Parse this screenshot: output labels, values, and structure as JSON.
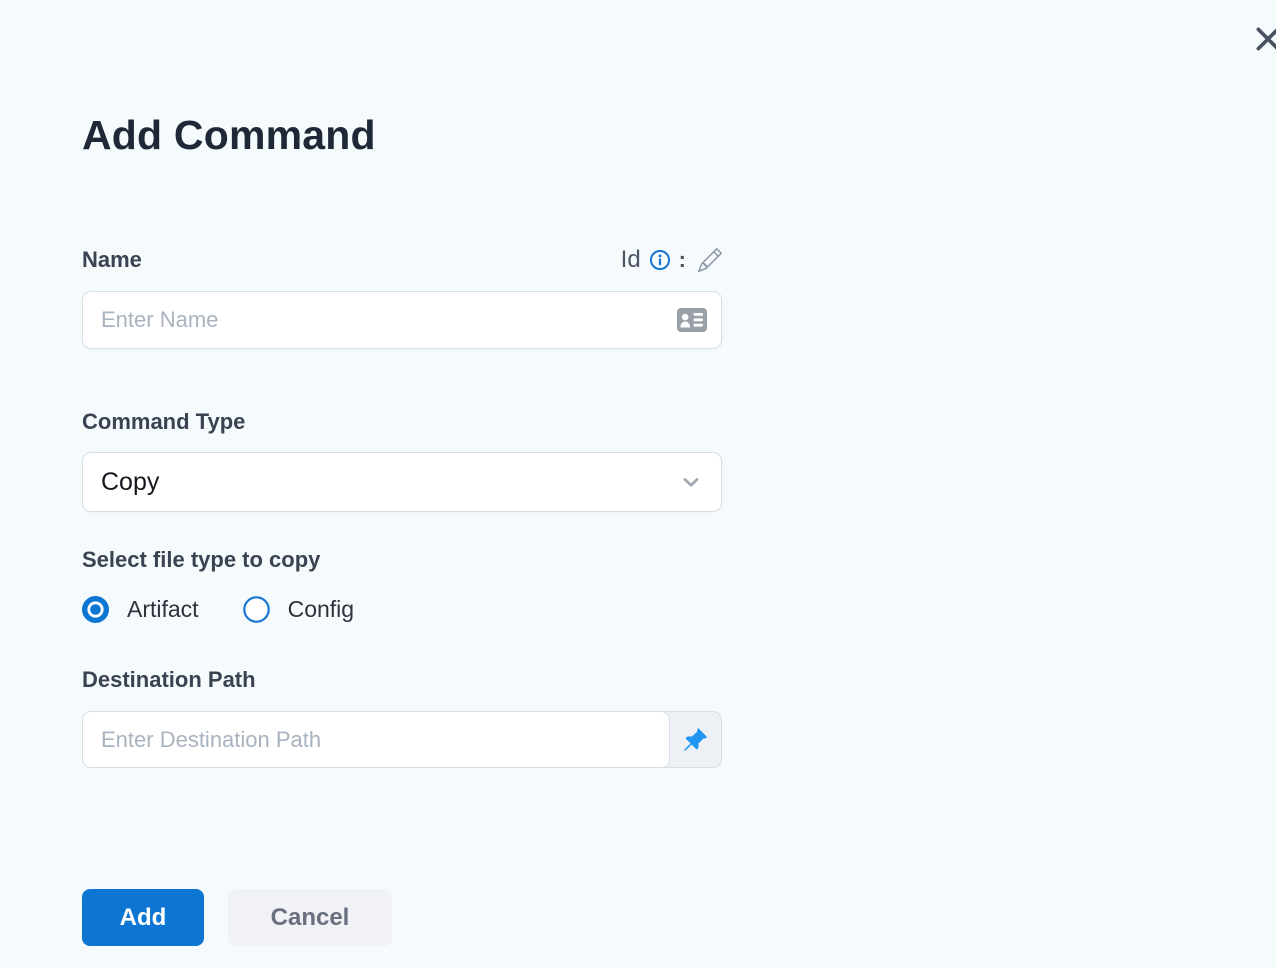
{
  "modal": {
    "title": "Add Command"
  },
  "fields": {
    "name": {
      "label": "Name",
      "id_label": "Id",
      "separator": ":",
      "placeholder": "Enter Name"
    },
    "command_type": {
      "label": "Command Type",
      "value": "Copy"
    },
    "file_type": {
      "label": "Select file type to copy",
      "options": [
        {
          "label": "Artifact",
          "selected": true
        },
        {
          "label": "Config",
          "selected": false
        }
      ]
    },
    "destination_path": {
      "label": "Destination Path",
      "placeholder": "Enter Destination Path"
    }
  },
  "actions": {
    "add_label": "Add",
    "cancel_label": "Cancel"
  },
  "icons": {
    "close": "x-icon",
    "info": "info-circle-icon",
    "edit": "pencil-icon",
    "name_suffix": "contact-card-icon",
    "select_caret": "chevron-down-icon",
    "destination_suffix": "pushpin-icon"
  },
  "colors": {
    "page_background": "#f5fafd",
    "title_text": "#1f2836",
    "label_text": "#3b4251",
    "placeholder_text": "#a9b3bf",
    "border": "#d9dee6",
    "accent_blue": "#0d76d3",
    "info_blue": "#1677d2",
    "pin_blue": "#2096f0",
    "cancel_bg": "#f0f2f5",
    "cancel_text": "#687080"
  }
}
